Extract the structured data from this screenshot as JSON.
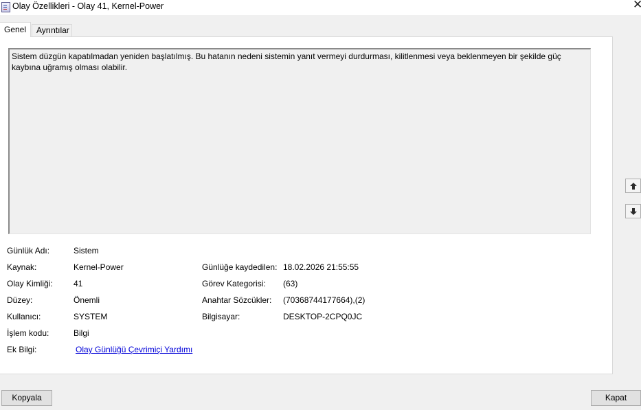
{
  "window": {
    "title": "Olay Özellikleri - Olay 41, Kernel-Power",
    "icon": "event-properties-icon",
    "close_glyph": "✕"
  },
  "tabs": [
    {
      "label": "Genel",
      "selected": true
    },
    {
      "label": "Ayrıntılar",
      "selected": false
    }
  ],
  "description": "Sistem düzgün kapatılmadan yeniden başlatılmış. Bu hatanın nedeni sistemin yanıt vermeyi durdurması, kilitlenmesi veya beklenmeyen bir şekilde güç kaybına uğramış olması olabilir.",
  "details_left": [
    {
      "label": "Günlük Adı:",
      "value": "Sistem"
    },
    {
      "label": "Kaynak:",
      "value": "Kernel-Power"
    },
    {
      "label": "Olay Kimliği:",
      "value": "41"
    },
    {
      "label": "Düzey:",
      "value": "Önemli"
    },
    {
      "label": "Kullanıcı:",
      "value": "SYSTEM"
    },
    {
      "label": "İşlem kodu:",
      "value": "Bilgi"
    },
    {
      "label": "Ek Bilgi:",
      "value": "Olay Günlüğü Çevrimiçi Yardımı"
    }
  ],
  "details_right": [
    {
      "label": "Günlüğe kaydedilen:",
      "value": "18.02.2026 21:55:55"
    },
    {
      "label": "Görev Kategorisi:",
      "value": "(63)"
    },
    {
      "label": "Anahtar Sözcükler:",
      "value": "(70368744177664),(2)"
    },
    {
      "label": "Bilgisayar:",
      "value": "DESKTOP-2CPQ0JC"
    }
  ],
  "navigation": {
    "up_icon": "arrow-up-icon",
    "down_icon": "arrow-down-icon"
  },
  "buttons": {
    "copy": "Kopyala",
    "close": "Kapat"
  },
  "colors": {
    "link": "#0000d8",
    "background": "#f0f0f0"
  }
}
